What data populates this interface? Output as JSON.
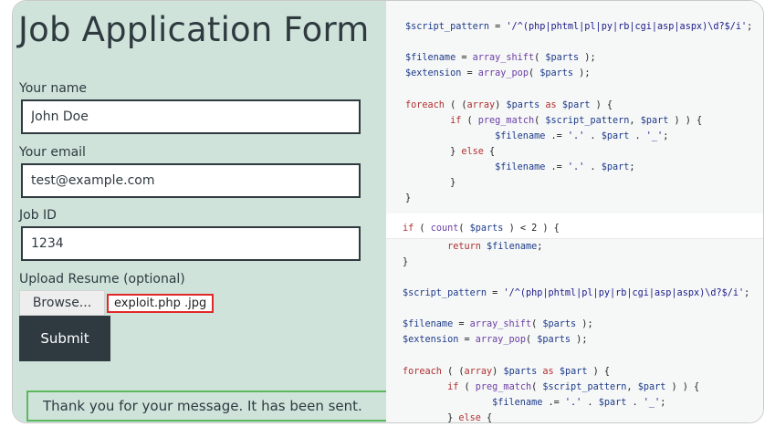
{
  "form": {
    "title": "Job Application Form",
    "name_label": "Your name",
    "name_value": "John Doe",
    "email_label": "Your email",
    "email_value": "test@example.com",
    "jobid_label": "Job ID",
    "jobid_value": "1234",
    "upload_label": "Upload Resume (optional)",
    "browse_label": "Browse...",
    "selected_file": "exploit.php .jpg",
    "submit_label": "Submit",
    "success_message": "Thank you for your message. It has been sent."
  },
  "code": {
    "block1": [
      "$script_pattern = '/^(php|phtml|pl|py|rb|cgi|asp|aspx)\\d?$/i';",
      "",
      "$filename = array_shift( $parts );",
      "$extension = array_pop( $parts );",
      "",
      "foreach ( (array) $parts as $part ) {",
      "        if ( preg_match( $script_pattern, $part ) ) {",
      "                $filename .= '.' . $part . '_';",
      "        } else {",
      "                $filename .= '.' . $part;",
      "        }",
      "}"
    ],
    "middle": [
      "if ( count( $parts ) < 2 ) {"
    ],
    "block2": [
      "        return $filename;",
      "}",
      "",
      "$script_pattern = '/^(php|phtml|pl|py|rb|cgi|asp|aspx)\\d?$/i';",
      "",
      "$filename = array_shift( $parts );",
      "$extension = array_pop( $parts );",
      "",
      "foreach ( (array) $parts as $part ) {",
      "        if ( preg_match( $script_pattern, $part ) ) {",
      "                $filename .= '.' . $part . '_';",
      "        } else {"
    ]
  },
  "colors": {
    "form_background": "#cfe3db",
    "dark": "#2e3a40",
    "highlight_border": "#e02828",
    "success_border": "#5cb85c"
  }
}
